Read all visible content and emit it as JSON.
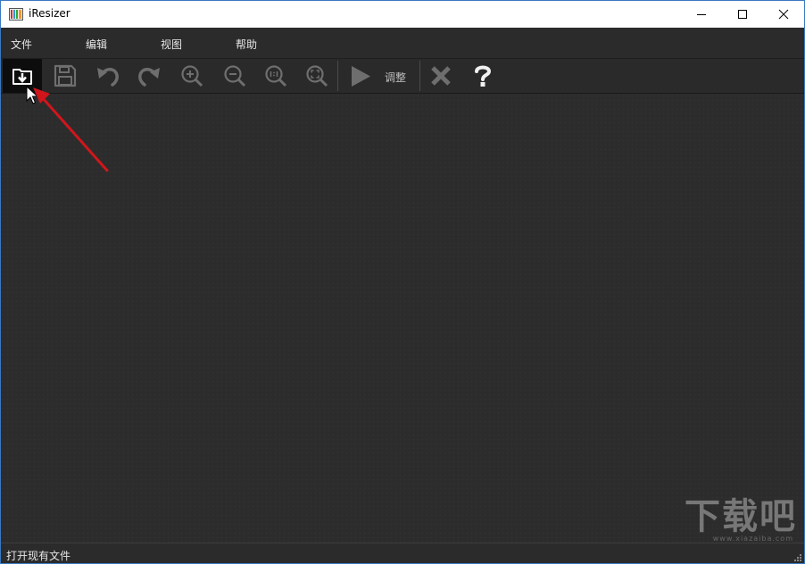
{
  "window": {
    "title": "iResizer"
  },
  "menu": {
    "file": "文件",
    "edit": "编辑",
    "view": "视图",
    "help": "帮助"
  },
  "toolbar": {
    "icons": [
      "open-file-icon",
      "save-icon",
      "undo-icon",
      "redo-icon",
      "zoom-in-icon",
      "zoom-out-icon",
      "actual-size-icon",
      "fit-screen-icon",
      "play-icon",
      "clear-icon",
      "help-icon"
    ],
    "adjust_label": "调整"
  },
  "status": {
    "text": "打开现有文件"
  },
  "watermark": {
    "text": "下载吧",
    "sub": "www.xiazaiba.com"
  },
  "colors": {
    "annotation_arrow": "#d0161b",
    "window_border": "#3a78c2"
  }
}
